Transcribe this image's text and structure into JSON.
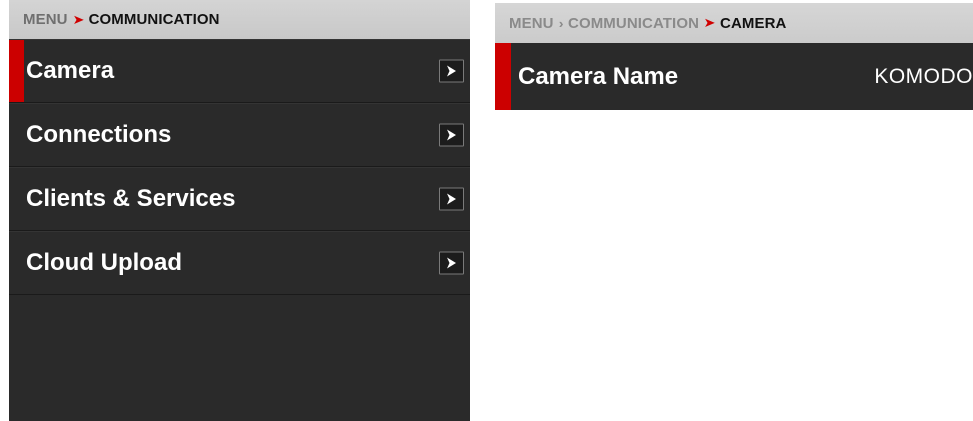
{
  "left_panel": {
    "breadcrumb": {
      "root": "MENU",
      "current": "COMMUNICATION"
    },
    "items": [
      {
        "label": "Camera",
        "selected": true
      },
      {
        "label": "Connections",
        "selected": false
      },
      {
        "label": "Clients & Services",
        "selected": false
      },
      {
        "label": "Cloud Upload",
        "selected": false
      }
    ]
  },
  "right_panel": {
    "breadcrumb": {
      "root": "MENU",
      "parent": "COMMUNICATION",
      "current": "CAMERA"
    },
    "setting": {
      "label": "Camera Name",
      "value": "KOMODO"
    }
  },
  "colors": {
    "accent": "#cc0000",
    "panel_bg": "#2a2a2a",
    "breadcrumb_bg": "#cfcfcf"
  },
  "icons": {
    "breadcrumb_separator": "chevron-right-icon",
    "row_arrow": "arrow-right-icon"
  }
}
